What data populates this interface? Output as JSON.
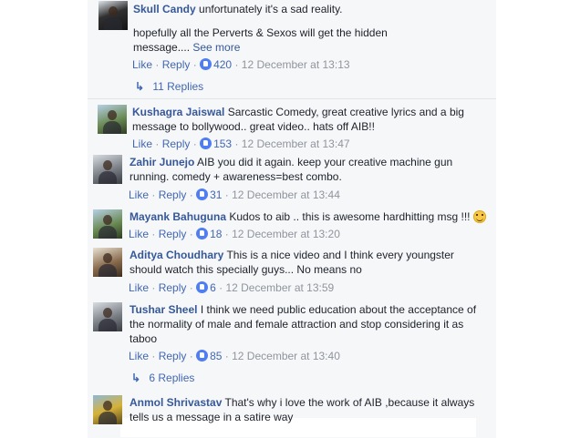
{
  "comments": [
    {
      "name": "Skull Candy",
      "line1": "unfortunately it's a sad reality.",
      "line2": "hopefully all the Perverts & Sexos will get the hidden",
      "line3": "message....",
      "see_more": "See more",
      "likes": "420",
      "timestamp": "12 December at 13:13",
      "replies": "11 Replies"
    },
    {
      "name": "Kushagra Jaiswal",
      "line1": "Sarcastic Comedy, great creative lyrics and a big",
      "line2": "message to bollywood.. great video.. hats off AIB!!",
      "likes": "153",
      "timestamp": "12 December at 13:47"
    },
    {
      "name": "Zahir Junejo",
      "line1": "AIB you did it again. keep your creative machine gun",
      "line2": "running. comedy + awareness=best combo.",
      "likes": "31",
      "timestamp": "12 December at 13:44"
    },
    {
      "name": "Mayank Bahuguna",
      "line1": "Kudos to aib .. this is awesome hardhitting msg !!!",
      "likes": "18",
      "timestamp": "12 December at 13:20",
      "emoji": "smile-emoji"
    },
    {
      "name": "Aditya Choudhary",
      "line1": "This is a nice video and I think every youngster",
      "line2": "should watch this specially guys... No means no",
      "likes": "6",
      "timestamp": "12 December at 13:59"
    },
    {
      "name": "Tushar Sheel",
      "line1": "I think we need public education about the acceptance of",
      "line2": "the normality of male and female attraction and stop considering it as",
      "line3": "taboo",
      "likes": "85",
      "timestamp": "12 December at 13:40",
      "replies": "6 Replies"
    },
    {
      "name": "Anmol Shrivastav",
      "line1": "That's why i love the work of AIB ,because it always",
      "line2": "tells us a message in a satire way"
    }
  ],
  "labels": {
    "like": "Like",
    "reply": "Reply",
    "separator": "·"
  },
  "colors": {
    "name_link": "#365899",
    "action_link": "#4267b2",
    "timestamp": "#90949c",
    "like_badge": "#4f7df2"
  }
}
